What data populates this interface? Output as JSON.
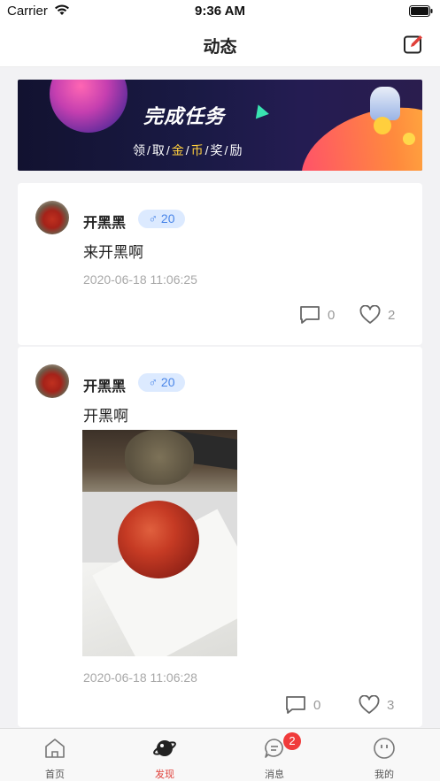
{
  "status_bar": {
    "carrier": "Carrier",
    "time": "9:36 AM"
  },
  "navbar": {
    "title": "动态",
    "compose_icon": "edit-icon"
  },
  "banner": {
    "title": "完成任务",
    "subtitle_parts": [
      "领/取/",
      "金",
      "/",
      "币",
      "/奖/励"
    ]
  },
  "posts": [
    {
      "username": "开黑黑",
      "gender_symbol": "♂",
      "level": "20",
      "content": "来开黑啊",
      "timestamp": "2020-06-18 11:06:25",
      "comments": "0",
      "likes": "2",
      "has_image": false
    },
    {
      "username": "开黑黑",
      "gender_symbol": "♂",
      "level": "20",
      "content": "开黑啊",
      "timestamp": "2020-06-18 11:06:28",
      "comments": "0",
      "likes": "3",
      "has_image": true
    }
  ],
  "tabbar": {
    "items": [
      {
        "label": "首页",
        "icon": "home-icon"
      },
      {
        "label": "发现",
        "icon": "planet-icon",
        "active": true
      },
      {
        "label": "消息",
        "icon": "message-icon",
        "badge": "2"
      },
      {
        "label": "我的",
        "icon": "profile-icon"
      }
    ]
  },
  "colors": {
    "accent": "#e0403a",
    "badge_bg": "#dceaff",
    "badge_text": "#4a86e8"
  }
}
